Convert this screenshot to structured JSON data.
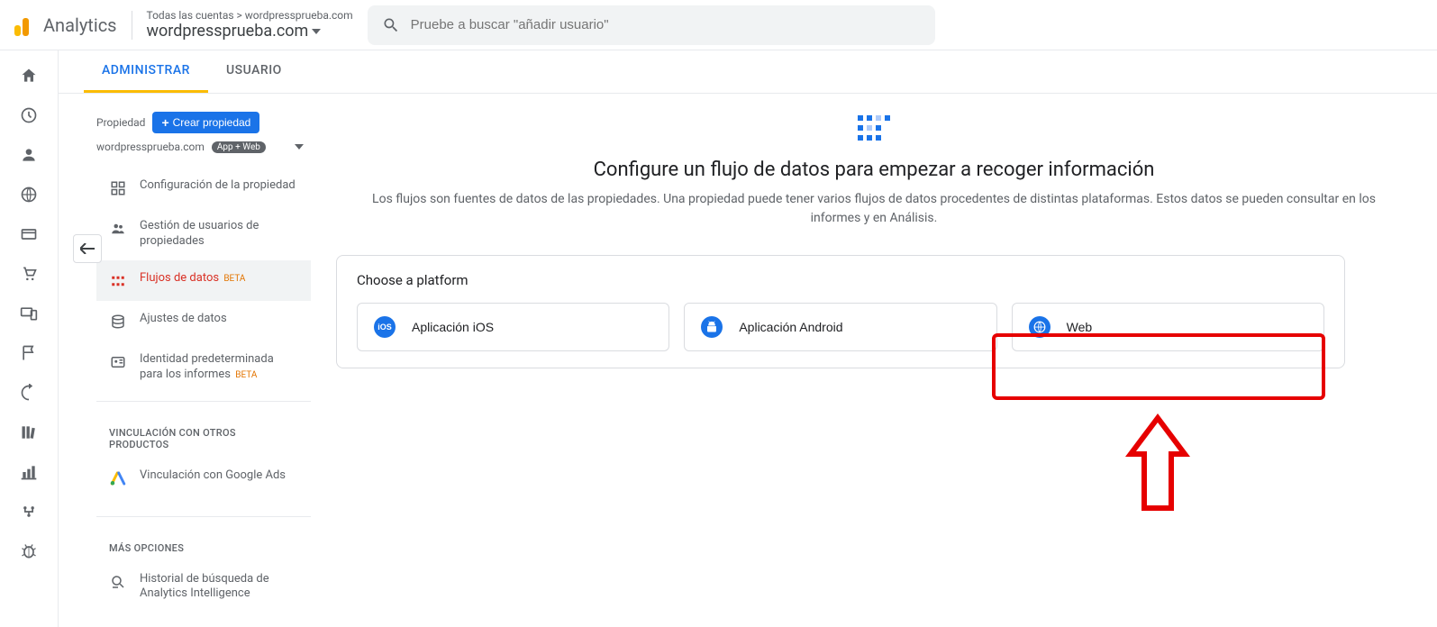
{
  "header": {
    "logo_text": "Analytics",
    "breadcrumb": "Todas las cuentas > wordpressprueba.com",
    "property_name": "wordpressprueba.com",
    "search_placeholder": "Pruebe a buscar \"añadir usuario\""
  },
  "tabs": {
    "admin": "ADMINISTRAR",
    "user": "USUARIO"
  },
  "sidebar": {
    "prop_label": "Propiedad",
    "create_btn": "Crear propiedad",
    "prop_name": "wordpressprueba.com",
    "badge": "App + Web",
    "items": [
      {
        "label": "Configuración de la propiedad",
        "beta": false
      },
      {
        "label": "Gestión de usuarios de propiedades",
        "beta": false
      },
      {
        "label": "Flujos de datos",
        "beta": true
      },
      {
        "label": "Ajustes de datos",
        "beta": false
      },
      {
        "label": "Identidad predeterminada para los informes",
        "beta": true
      }
    ],
    "section_linking": "VINCULACIÓN CON OTROS PRODUCTOS",
    "google_ads": "Vinculación con Google Ads",
    "section_more": "MÁS OPCIONES",
    "history": "Historial de búsqueda de Analytics Intelligence"
  },
  "main": {
    "hero_title": "Configure un flujo de datos para empezar a recoger información",
    "hero_desc": "Los flujos son fuentes de datos de las propiedades. Una propiedad puede tener varios flujos de datos procedentes de distintas plataformas. Estos datos se pueden consultar en los informes y en Análisis.",
    "choose_platform": "Choose a platform",
    "platforms": {
      "ios": "Aplicación iOS",
      "android": "Aplicación Android",
      "web": "Web"
    }
  }
}
